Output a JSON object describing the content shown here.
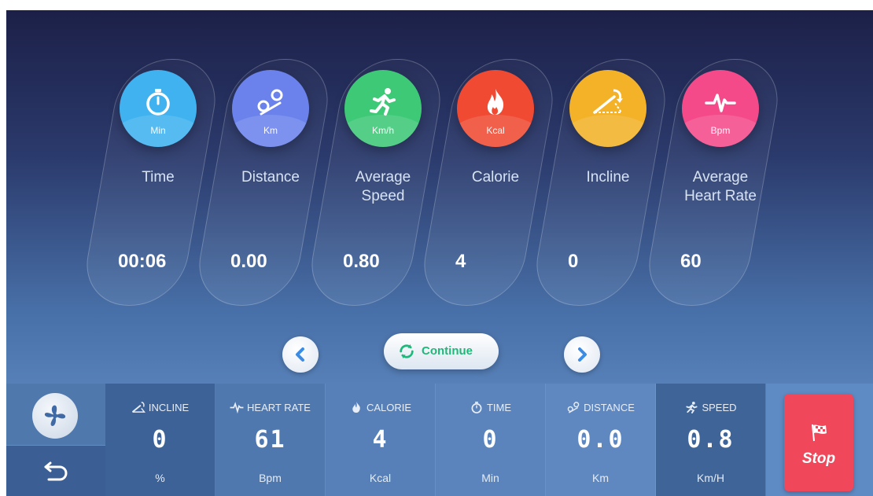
{
  "summary_cards": [
    {
      "label": "Time",
      "unit": "Min",
      "value": "00:06",
      "icon": "stopwatch-icon",
      "color": "#3fb2ef"
    },
    {
      "label": "Distance",
      "unit": "Km",
      "value": "0.00",
      "icon": "route-pin-icon",
      "color": "#6b82ec"
    },
    {
      "label": "Average\nSpeed",
      "unit": "Km/h",
      "value": "0.80",
      "icon": "runner-icon",
      "color": "#3ec977"
    },
    {
      "label": "Calorie",
      "unit": "Kcal",
      "value": "4",
      "icon": "flame-icon",
      "color": "#f04a33"
    },
    {
      "label": "Incline",
      "unit": "",
      "value": "0",
      "icon": "incline-icon",
      "color": "#f3b228"
    },
    {
      "label": "Average\nHeart Rate",
      "unit": "Bpm",
      "value": "60",
      "icon": "heartbeat-icon",
      "color": "#f54a8a"
    }
  ],
  "nav": {
    "continue_label": "Continue"
  },
  "bottom_bar": {
    "metrics": [
      {
        "label": "INCLINE",
        "value": "0",
        "unit": "%",
        "icon": "incline-icon",
        "bg": "#3d6297"
      },
      {
        "label": "HEART RATE",
        "value": "61",
        "unit": "Bpm",
        "icon": "heartbeat-icon",
        "bg": "#4f78ae"
      },
      {
        "label": "CALORIE",
        "value": "4",
        "unit": "Kcal",
        "icon": "flame-icon",
        "bg": "#5680b7"
      },
      {
        "label": "TIME",
        "value": "0",
        "unit": "Min",
        "icon": "stopwatch-icon",
        "bg": "#5a84bb"
      },
      {
        "label": "DISTANCE",
        "value": "0.0",
        "unit": "Km",
        "icon": "route-pin-icon",
        "bg": "#5e88bf"
      },
      {
        "label": "SPEED",
        "value": "0.8",
        "unit": "Km/H",
        "icon": "runner-icon",
        "bg": "#3e6498"
      }
    ],
    "stop_label": "Stop"
  }
}
